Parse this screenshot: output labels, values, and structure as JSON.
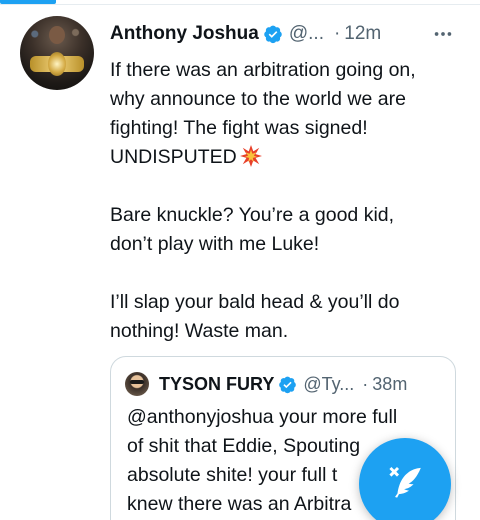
{
  "tweet": {
    "author": {
      "display_name": "Anthony Joshua",
      "handle": "@...",
      "verified": true
    },
    "separator": "·",
    "time": "12m",
    "body": {
      "line1": "If there was an arbitration going on,",
      "line2": "why announce to the world we are",
      "line3": "fighting! The fight was signed!",
      "line4": "UNDISPUTED",
      "line5": "Bare knuckle? You’re a good kid,",
      "line6": "don’t play with me Luke!",
      "line7": "I’ll slap your bald head & you’ll do",
      "line8": "nothing! Waste man."
    },
    "emoji": "collision-icon"
  },
  "quoted_tweet": {
    "author": {
      "display_name": "TYSON FURY",
      "handle": "@Ty...",
      "verified": true
    },
    "separator": "·",
    "time": "38m",
    "body": {
      "line1": "@anthonyjoshua your more full",
      "line2": "of shit that Eddie, Spouting",
      "line3": "absolute shite! your full t",
      "line4": "knew there was an Arbitra"
    }
  },
  "fab": {
    "icon": "compose-tweet-icon"
  },
  "colors": {
    "accent": "#1da1f2",
    "text": "#0f1419",
    "muted": "#536471",
    "border": "#cfd9de"
  }
}
